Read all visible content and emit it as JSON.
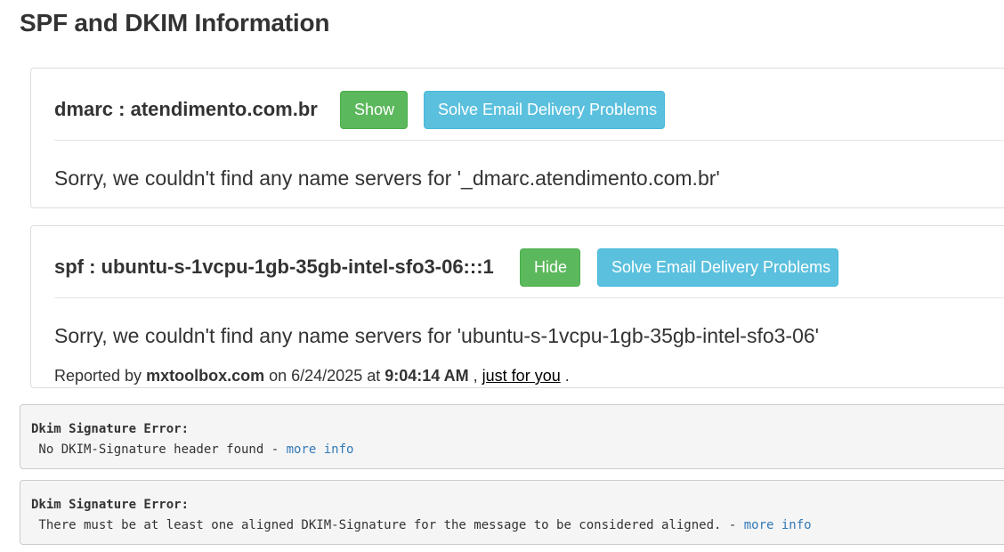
{
  "page": {
    "title": "SPF and DKIM Information"
  },
  "dmarc": {
    "heading": "dmarc : atendimento.com.br",
    "show_label": "Show",
    "solve_label": "Solve Email Delivery Problems",
    "message": "Sorry, we couldn't find any name servers for '_dmarc.atendimento.com.br'"
  },
  "spf": {
    "heading": "spf : ubuntu-s-1vcpu-1gb-35gb-intel-sfo3-06:::1",
    "hide_label": "Hide",
    "solve_label": "Solve Email Delivery Problems",
    "message": "Sorry, we couldn't find any name servers for 'ubuntu-s-1vcpu-1gb-35gb-intel-sfo3-06'",
    "reported": {
      "prefix": "Reported by",
      "site": "mxtoolbox.com",
      "on": "on 6/24/2025 at",
      "time": "9:04:14 AM",
      "comma": ",",
      "link": "just for you",
      "end": "."
    }
  },
  "dkim_errors": [
    {
      "title": "Dkim Signature Error:",
      "message": " No DKIM-Signature header found - ",
      "link": "more info"
    },
    {
      "title": "Dkim Signature Error:",
      "message": " There must be at least one aligned DKIM-Signature for the message to be considered aligned. - ",
      "link": "more info"
    }
  ],
  "colors": {
    "success": "#5cb85c",
    "info": "#5bc0de",
    "link": "#337ab7"
  }
}
